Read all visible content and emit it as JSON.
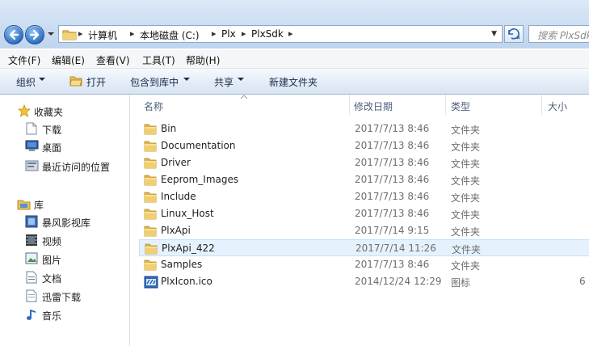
{
  "address": {
    "crumbs": [
      "计算机",
      "本地磁盘 (C:)",
      "Plx",
      "PlxSdk"
    ],
    "separator": "▸",
    "search_placeholder": "搜索 PlxSdk"
  },
  "menu": [
    "文件(F)",
    "编辑(E)",
    "查看(V)",
    "工具(T)",
    "帮助(H)"
  ],
  "toolbar": {
    "organize": "组织",
    "open": "打开",
    "include": "包含到库中",
    "share": "共享",
    "new_folder": "新建文件夹"
  },
  "nav": {
    "favorites": "收藏夹",
    "downloads": "下载",
    "desktop": "桌面",
    "recent": "最近访问的位置",
    "libraries": "库",
    "videos_lib": "暴风影视库",
    "video": "视频",
    "pictures": "图片",
    "documents": "文档",
    "thunder": "迅雷下载",
    "music": "音乐"
  },
  "columns": {
    "name": "名称",
    "date": "修改日期",
    "type": "类型",
    "size": "大小"
  },
  "files": [
    {
      "name": "Bin",
      "date": "2017/7/13 8:46",
      "type": "文件夹",
      "size": "",
      "icon": "folder-icon"
    },
    {
      "name": "Documentation",
      "date": "2017/7/13 8:46",
      "type": "文件夹",
      "size": "",
      "icon": "folder-icon"
    },
    {
      "name": "Driver",
      "date": "2017/7/13 8:46",
      "type": "文件夹",
      "size": "",
      "icon": "folder-icon"
    },
    {
      "name": "Eeprom_Images",
      "date": "2017/7/13 8:46",
      "type": "文件夹",
      "size": "",
      "icon": "folder-icon"
    },
    {
      "name": "Include",
      "date": "2017/7/13 8:46",
      "type": "文件夹",
      "size": "",
      "icon": "folder-icon"
    },
    {
      "name": "Linux_Host",
      "date": "2017/7/13 8:46",
      "type": "文件夹",
      "size": "",
      "icon": "folder-icon"
    },
    {
      "name": "PlxApi",
      "date": "2017/7/14 9:15",
      "type": "文件夹",
      "size": "",
      "icon": "folder-icon"
    },
    {
      "name": "PlxApi_422",
      "date": "2017/7/14 11:26",
      "type": "文件夹",
      "size": "",
      "icon": "folder-icon",
      "selected": true
    },
    {
      "name": "Samples",
      "date": "2017/7/13 8:46",
      "type": "文件夹",
      "size": "",
      "icon": "folder-icon"
    },
    {
      "name": "PlxIcon.ico",
      "date": "2014/12/24 12:29",
      "type": "图标",
      "size": "6",
      "icon": "plx-icon-file-icon"
    }
  ]
}
